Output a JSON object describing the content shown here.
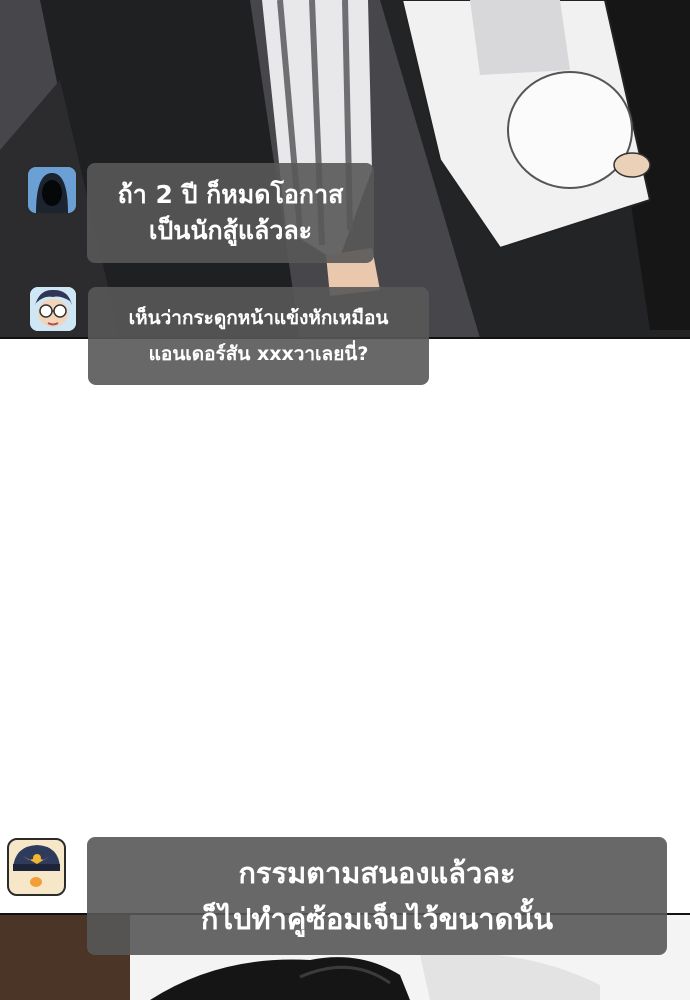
{
  "comments": [
    {
      "avatar_icon": "hooded-figure-avatar-icon",
      "lines": [
        "ถ้า 2 ปี ก็หมดโอกาส",
        "เป็นนักสู้แล้วละ"
      ]
    },
    {
      "avatar_icon": "glasses-kid-avatar-icon",
      "lines": [
        "เห็นว่ากระดูกหน้าแข้งหักเหมือน",
        "แอนเดอร์สัน xxxวาเลยนี่?"
      ]
    },
    {
      "avatar_icon": "police-badge-avatar-icon",
      "lines": [
        "กรรมตามสนองแล้วละ",
        "ก็ไปทำคู่ซ้อมเจ็บไว้ขนาดนั้น"
      ]
    }
  ],
  "colors": {
    "bubble_bg": "#585858",
    "bubble_text": "#ffffff",
    "panel_dark": "#3a3a3e"
  }
}
